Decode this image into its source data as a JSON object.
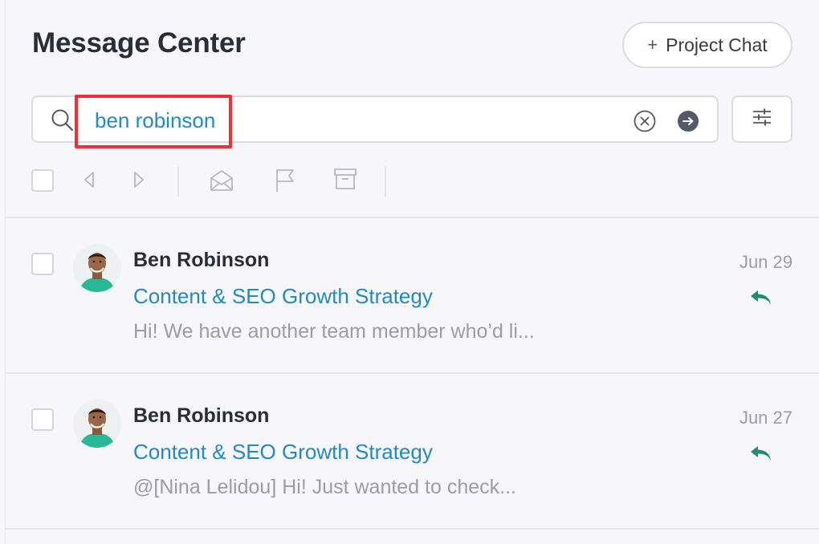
{
  "header": {
    "title": "Message Center",
    "project_chat_label": "Project Chat",
    "project_chat_icon": "plus-icon"
  },
  "search": {
    "value": "ben robinson",
    "icons": [
      "search-icon",
      "clear-icon",
      "go-arrow-icon"
    ]
  },
  "toolbar": {
    "items": [
      "select-all-checkbox",
      "prev-icon",
      "next-icon",
      "mark-read-icon",
      "flag-icon",
      "archive-icon"
    ],
    "filter_icon": "sliders-icon"
  },
  "colors": {
    "accent_blue": "#1f8ac9",
    "reply_green": "#1d8f6d",
    "highlight_red": "#ee2f35",
    "muted_text": "#9d9ca3"
  },
  "messages": [
    {
      "sender": "Ben Robinson",
      "subject": "Content & SEO Growth Strategy",
      "preview": "Hi! We have another team member who’d li...",
      "date": "Jun 29",
      "status_icon": "reply-icon"
    },
    {
      "sender": "Ben Robinson",
      "subject": "Content & SEO Growth Strategy",
      "preview": "@[Nina Lelidou] Hi! Just wanted to check...",
      "date": "Jun 27",
      "status_icon": "reply-icon"
    }
  ]
}
